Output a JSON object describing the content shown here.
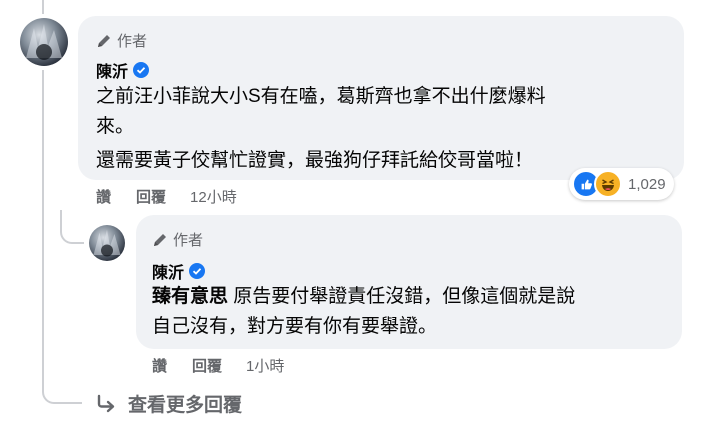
{
  "comment": {
    "author_tag": "作者",
    "name": "陳沂",
    "lines": [
      "之前汪小菲說大小S有在嗑，葛斯齊也拿不出什麼爆料",
      "來。",
      "還需要黃子佼幫忙證實，最強狗仔拜託給佼哥當啦！"
    ],
    "actions": {
      "like": "讚",
      "reply": "回覆",
      "time": "12小時"
    },
    "reactions": {
      "count": "1,029",
      "types": [
        "like-icon",
        "haha-icon"
      ]
    }
  },
  "reply": {
    "author_tag": "作者",
    "name": "陳沂",
    "mention": "臻有意思",
    "line1": "原告要付舉證責任沒錯，但像這個就是說",
    "line2": "自己沒有，對方要有你有要舉證。",
    "actions": {
      "like": "讚",
      "reply": "回覆",
      "time": "1小時"
    }
  },
  "more_replies": {
    "label": "查看更多回覆"
  },
  "colors": {
    "bubble": "#f0f2f5",
    "secondary_text": "#65676b",
    "verified": "#1877f2",
    "like": "#1877f2",
    "haha": "#f7b125"
  }
}
